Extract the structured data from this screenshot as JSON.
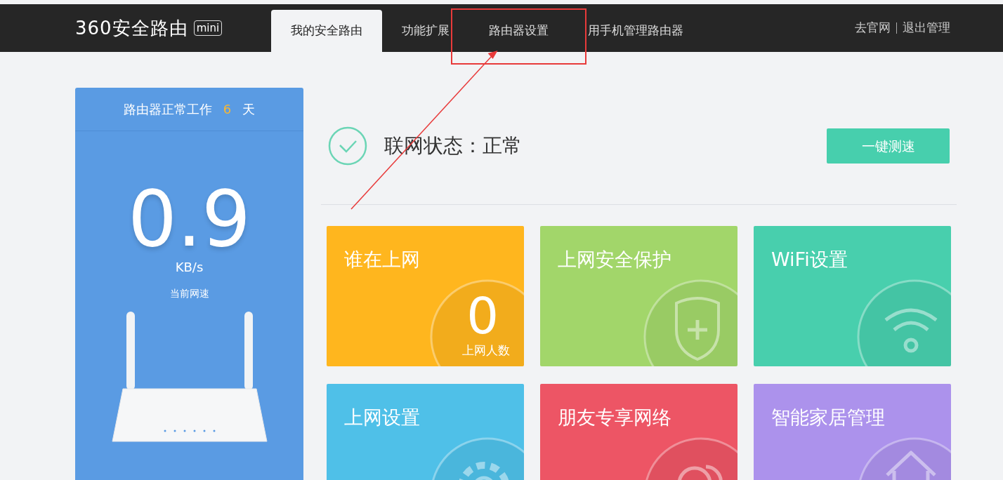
{
  "header": {
    "logo": "360安全路由",
    "logo_badge": "mini",
    "tabs": [
      {
        "label": "我的安全路由",
        "selected": true,
        "highlighted": false
      },
      {
        "label": "功能扩展",
        "selected": false,
        "highlighted": false
      },
      {
        "label": "路由器设置",
        "selected": false,
        "highlighted": true
      },
      {
        "label": "用手机管理路由器",
        "selected": false,
        "highlighted": false
      }
    ],
    "links": [
      "去官网",
      "退出管理"
    ]
  },
  "uptime": {
    "prefix": "路由器正常工作",
    "days": "6",
    "suffix": "天"
  },
  "speed": {
    "value": "0.9",
    "unit": "KB/s",
    "label": "当前网速"
  },
  "status": {
    "text": "联网状态：正常",
    "button": "一键测速"
  },
  "tiles": [
    {
      "title": "谁在上网",
      "color": "#ffb61e",
      "kind": "counter",
      "count": "0",
      "count_label": "上网人数"
    },
    {
      "title": "上网安全保护",
      "color": "#a2d66a",
      "kind": "shield"
    },
    {
      "title": "WiFi设置",
      "color": "#48cfad",
      "kind": "wifi"
    },
    {
      "title": "上网设置",
      "color": "#4fc0e8",
      "kind": "gear"
    },
    {
      "title": "朋友专享网络",
      "color": "#ed5565",
      "kind": "people"
    },
    {
      "title": "智能家居管理",
      "color": "#ac92ec",
      "kind": "home"
    }
  ]
}
